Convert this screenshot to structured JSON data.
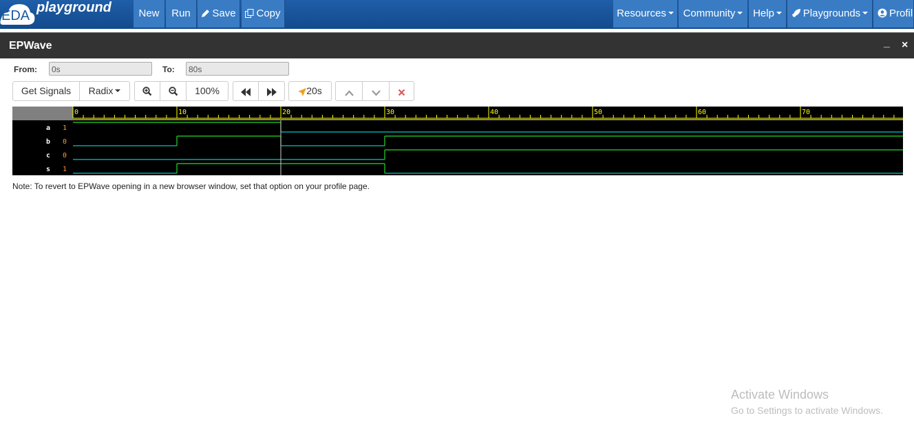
{
  "navbar": {
    "logo_eda": "EDA",
    "logo_text": "playground",
    "new_label": "New",
    "run_label": "Run",
    "save_label": "Save",
    "copy_label": "Copy",
    "resources_label": "Resources",
    "community_label": "Community",
    "help_label": "Help",
    "playgrounds_label": "Playgrounds",
    "profile_label": "Profil"
  },
  "modal": {
    "title": "EPWave",
    "minimize": "_",
    "close": "×"
  },
  "range": {
    "from_label": "From:",
    "from_value": "0s",
    "to_label": "To:",
    "to_value": "80s"
  },
  "toolbar": {
    "get_signals": "Get Signals",
    "radix": "Radix",
    "zoom_level": "100%",
    "cursor_time": "20s"
  },
  "wave": {
    "ticks": [
      "0",
      "10",
      "20",
      "30",
      "40",
      "50",
      "60",
      "70"
    ],
    "signals": [
      {
        "name": "a",
        "value": "1"
      },
      {
        "name": "b",
        "value": "0"
      },
      {
        "name": "c",
        "value": "0"
      },
      {
        "name": "s",
        "value": "1"
      }
    ],
    "colors": {
      "low": "#00c8c8",
      "high": "#22dd22",
      "tick": "#ffff00",
      "value": "#ff9933",
      "cursor": "#ffffff"
    }
  },
  "note": "Note: To revert to EPWave opening in a new browser window, set that option on your profile page.",
  "watermark": {
    "line1": "Activate Windows",
    "line2": "Go to Settings to activate Windows."
  }
}
